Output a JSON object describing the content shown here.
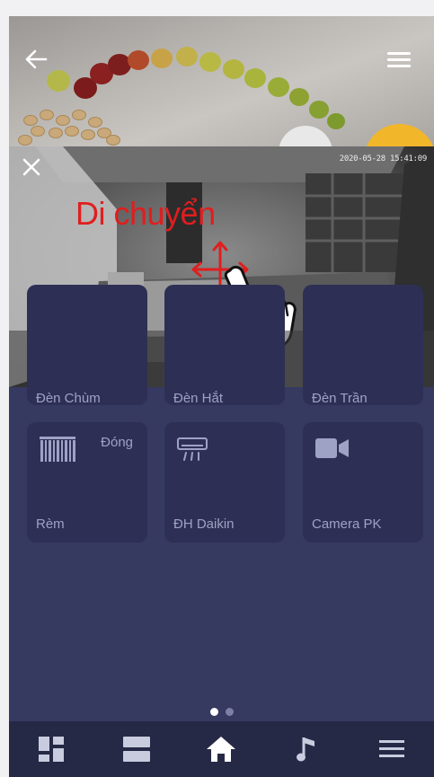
{
  "header": {
    "back_icon": "arrow-left-icon",
    "menu_icon": "hamburger-menu-icon"
  },
  "camera": {
    "timestamp": "2020-05-28 15:41:09",
    "hint_text": "Di chuyển",
    "close_icon": "close-icon",
    "pause_icon": "pause-icon",
    "fullscreen_icon": "fullscreen-icon",
    "gesture_icon": "hand-drag-icon"
  },
  "partial_row": {
    "labels": [
      "Đèn Chùm",
      "Đèn Hắt",
      "Đèn Trần"
    ]
  },
  "devices": [
    {
      "label": "Rèm",
      "status": "Đóng",
      "icon": "curtain-icon"
    },
    {
      "label": "ĐH Daikin",
      "status": "",
      "icon": "air-conditioner-icon"
    },
    {
      "label": "Camera PK",
      "status": "",
      "icon": "video-camera-icon"
    }
  ],
  "pagination": {
    "pages": 2,
    "current": 1
  },
  "bottom_nav": [
    {
      "icon": "dashboard-icon",
      "active": false
    },
    {
      "icon": "rooms-icon",
      "active": false
    },
    {
      "icon": "home-icon",
      "active": true
    },
    {
      "icon": "music-icon",
      "active": false
    },
    {
      "icon": "menu-icon",
      "active": false
    }
  ],
  "colors": {
    "background": "#363960",
    "tile": "#2d3054",
    "nav": "#262945",
    "text_muted": "#9ea2c4",
    "hint_red": "#e01e1e"
  }
}
